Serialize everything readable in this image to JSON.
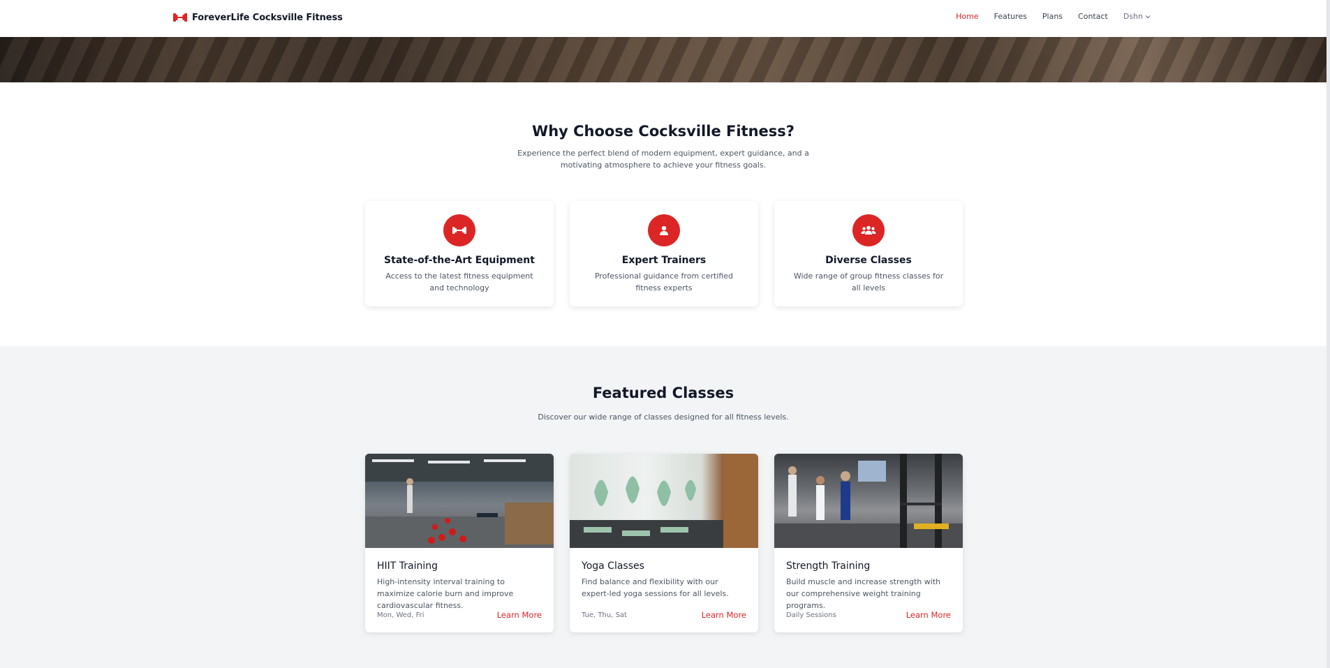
{
  "brand": {
    "name": "ForeverLife Cocksville Fitness",
    "icon": "dumbbell-icon",
    "accent": "#dc2626"
  },
  "nav": {
    "items": [
      {
        "label": "Home",
        "active": true
      },
      {
        "label": "Features",
        "active": false
      },
      {
        "label": "Plans",
        "active": false
      },
      {
        "label": "Contact",
        "active": false
      }
    ],
    "user": {
      "label": "Dshn",
      "icon": "chevron-down-icon"
    }
  },
  "why": {
    "title": "Why Choose Cocksville Fitness?",
    "subtitle": "Experience the perfect blend of modern equipment, expert guidance, and a motivating atmosphere to achieve your fitness goals.",
    "features": [
      {
        "icon": "dumbbell-icon",
        "title": "State-of-the-Art Equipment",
        "desc": "Access to the latest fitness equipment and technology"
      },
      {
        "icon": "user-icon",
        "title": "Expert Trainers",
        "desc": "Professional guidance from certified fitness experts"
      },
      {
        "icon": "users-icon",
        "title": "Diverse Classes",
        "desc": "Wide range of group fitness classes for all levels"
      }
    ]
  },
  "classes": {
    "title": "Featured Classes",
    "subtitle": "Discover our wide range of classes designed for all fitness levels.",
    "items": [
      {
        "title": "HIIT Training",
        "desc": "High-intensity interval training to maximize calorie burn and improve cardiovascular fitness.",
        "schedule": "Mon, Wed, Fri",
        "link": "Learn More"
      },
      {
        "title": "Yoga Classes",
        "desc": "Find balance and flexibility with our expert-led yoga sessions for all levels.",
        "schedule": "Tue, Thu, Sat",
        "link": "Learn More"
      },
      {
        "title": "Strength Training",
        "desc": "Build muscle and increase strength with our comprehensive weight training programs.",
        "schedule": "Daily Sessions",
        "link": "Learn More"
      }
    ]
  }
}
